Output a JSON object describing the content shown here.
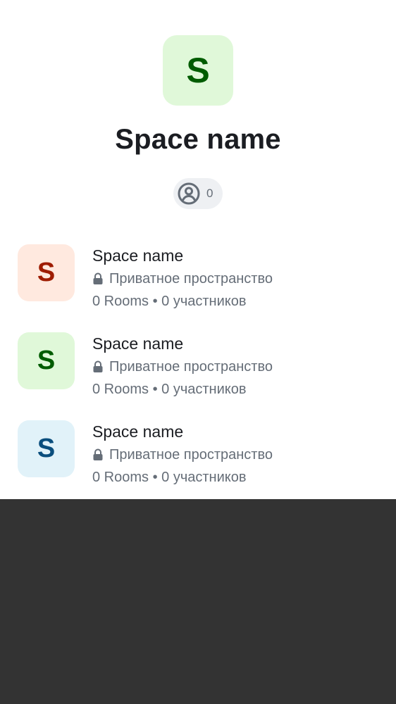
{
  "header": {
    "avatar_letter": "S",
    "title": "Space name",
    "members_count": "0",
    "avatar_bg": "#e0f8d9",
    "avatar_fg": "#005c00"
  },
  "icons": {
    "members": "user-circle-icon",
    "privacy": "lock-icon"
  },
  "spaces": [
    {
      "avatar_letter": "S",
      "title": "Space name",
      "privacy": "Приватное пространство",
      "meta": "0 Rooms • 0 участников",
      "avatar_bg": "#ffe9df",
      "avatar_fg": "#9e1c00"
    },
    {
      "avatar_letter": "S",
      "title": "Space name",
      "privacy": "Приватное пространство",
      "meta": "0 Rooms • 0 участников",
      "avatar_bg": "#e0f8d9",
      "avatar_fg": "#005c00"
    },
    {
      "avatar_letter": "S",
      "title": "Space name",
      "privacy": "Приватное пространство",
      "meta": "0 Rooms • 0 участников",
      "avatar_bg": "#e1f2f9",
      "avatar_fg": "#0a4e7d"
    }
  ]
}
